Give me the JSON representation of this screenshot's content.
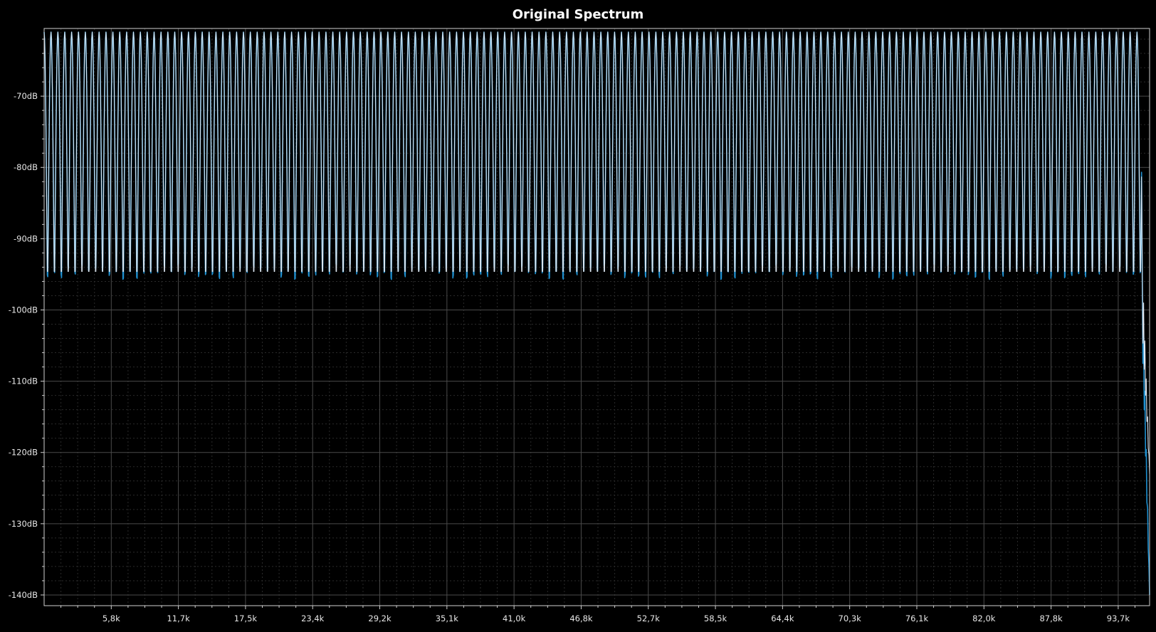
{
  "chart_data": {
    "type": "line",
    "title": "Original Spectrum",
    "xlabel": "",
    "ylabel": "",
    "xlim": [
      0,
      96500
    ],
    "ylim": [
      -141.5,
      -60.5
    ],
    "y_ticks": [
      -70,
      -80,
      -90,
      -100,
      -110,
      -120,
      -130,
      -140
    ],
    "y_tick_labels": [
      "-70dB",
      "-80dB",
      "-90dB",
      "-100dB",
      "-110dB",
      "-120dB",
      "-130dB",
      "-140dB"
    ],
    "x_ticks": [
      5860,
      11720,
      17580,
      23440,
      29300,
      35160,
      41020,
      46880,
      52740,
      58600,
      64460,
      70320,
      76180,
      82040,
      87900,
      93760
    ],
    "x_tick_labels": [
      "5,8k",
      "11,7k",
      "17,5k",
      "23,4k",
      "29,2k",
      "35,1k",
      "41,0k",
      "46,8k",
      "52,7k",
      "58,5k",
      "64,4k",
      "70,3k",
      "76,1k",
      "82,0k",
      "87,8k",
      "93,7k"
    ],
    "grid": true,
    "series": [
      {
        "color": "#1e90d0",
        "description_values": {
          "peak_spacing_hz": 600,
          "peak_level_db": -61,
          "trough_level_db": -97,
          "rolloff_start_hz": 95800,
          "rolloff_end_db": -140
        }
      },
      {
        "color": "#dce6f0",
        "description_values": {
          "peak_spacing_hz": 600,
          "peak_level_db": -61,
          "trough_level_db": -97,
          "rolloff_start_hz": 95800,
          "rolloff_end_db": -123
        }
      }
    ]
  },
  "colors": {
    "background": "#000000",
    "grid_major": "#4a4a4a",
    "grid_minor": "#2a2a2a",
    "axis": "#cfcfcf",
    "text": "#ffffff"
  }
}
